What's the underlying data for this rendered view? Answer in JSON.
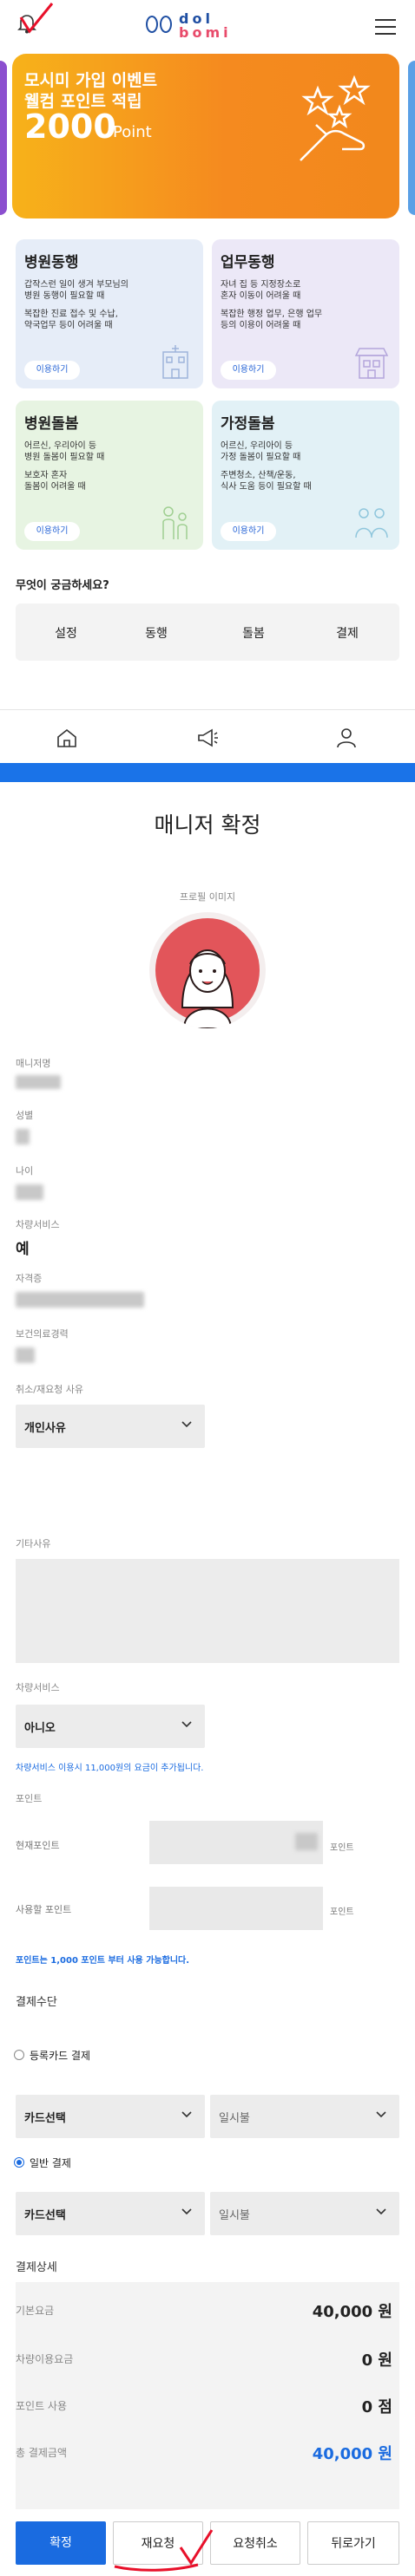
{
  "header": {
    "logo_top": "dol",
    "logo_bottom": "bomi"
  },
  "banner": {
    "line1": "모시미 가입 이벤트",
    "line2": "웰컴 포인트 적립",
    "points": "2000",
    "unit": "Point"
  },
  "services": [
    {
      "title": "병원동행",
      "desc1": "갑작스런 일이 생겨 부모님의",
      "desc2": "병원 동행이 필요할 때",
      "desc3": "복잡한 진료 접수 및 수납,",
      "desc4": "약국업무 등이 어려울 때",
      "button": "이용하기"
    },
    {
      "title": "업무동행",
      "desc1": "자녀 집 등 지정장소로",
      "desc2": "혼자 이동이 어려울 때",
      "desc3": "복잡한 행정 업무, 은행 업무",
      "desc4": "등의 이용이 어려울 때",
      "button": "이용하기"
    },
    {
      "title": "병원돌봄",
      "desc1": "어르신, 우리아이 등",
      "desc2": "병원 돌봄이 필요할 때",
      "desc3": "보호자 혼자",
      "desc4": "돌봄이 어려울 때",
      "button": "이용하기"
    },
    {
      "title": "가정돌봄",
      "desc1": "어르신, 우리아이 등",
      "desc2": "가정 돌봄이 필요할 때",
      "desc3": "주변청소, 산책/운동,",
      "desc4": "식사 도움 등이 필요할 때",
      "button": "이용하기"
    }
  ],
  "faq": {
    "title": "무엇이 궁금하세요?",
    "items": [
      "설정",
      "동행",
      "돌봄",
      "결제"
    ]
  },
  "confirm": {
    "title": "매니저 확정",
    "profile_label": "프로필 이미지",
    "manager_name_label": "매니저명",
    "gender_label": "성별",
    "age_label": "나이",
    "vehicle_label": "차량서비스",
    "vehicle_value": "예",
    "license_label": "자격증",
    "experience_label": "보건의료경력",
    "reason_label": "취소/재요청 사유",
    "reason_value": "개인사유",
    "other_reason_label": "기타사유",
    "vehicle_service_label": "차량서비스",
    "vehicle_service_value": "아니오",
    "vehicle_note": "차량서비스 이용시 11,000원의 요금이 추가됩니다.",
    "point_label": "포인트",
    "current_point_label": "현재포인트",
    "use_point_label": "사용할 포인트",
    "point_unit": "포인트",
    "point_note": "포인트는 1,000 포인트 부터 사용 가능합니다.",
    "payment_label": "결제수단",
    "registered_card_label": "등록카드 결제",
    "card_select": "카드선택",
    "installment": "일시불",
    "general_payment_label": "일반 결제",
    "detail_label": "결제상세",
    "base_fee_label": "기본요금",
    "base_fee_value": "40,000 원",
    "vehicle_fee_label": "차량이용요금",
    "vehicle_fee_value": "0 원",
    "point_use_label": "포인트 사용",
    "point_use_value": "0 점",
    "total_label": "총 결제금액",
    "total_value": "40,000 원"
  },
  "buttons": {
    "confirm": "확정",
    "rerequest": "재요청",
    "cancel": "요청취소",
    "back": "뒤로가기"
  },
  "colors": {
    "accent": "#1a73e8",
    "banner": "#f58a1f",
    "annotation": "#e8102a"
  }
}
